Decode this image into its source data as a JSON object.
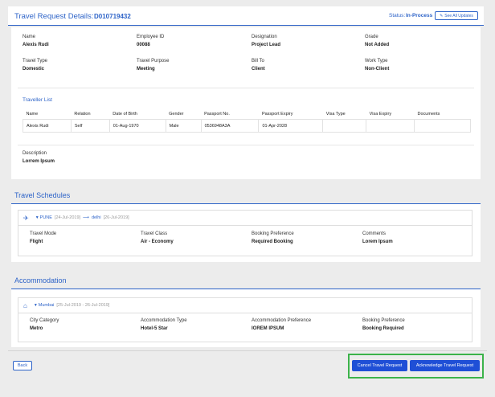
{
  "header": {
    "title": "Travel Request Details:",
    "request_id": "D010719432",
    "status_label": "Status:",
    "status_value": "In-Process",
    "see_updates_label": "See All Updates"
  },
  "details": {
    "row1": [
      {
        "label": "Name",
        "value": "Alexis Rudi"
      },
      {
        "label": "Employee ID",
        "value": "00088"
      },
      {
        "label": "Designation",
        "value": "Project Lead"
      },
      {
        "label": "Grade",
        "value": "Not Added"
      }
    ],
    "row2": [
      {
        "label": "Travel Type",
        "value": "Domestic"
      },
      {
        "label": "Travel Purpose",
        "value": "Meeting"
      },
      {
        "label": "Bill To",
        "value": "Client"
      },
      {
        "label": "Work Type",
        "value": "Non-Client"
      }
    ]
  },
  "traveller_list": {
    "title": "Traveller List",
    "columns": [
      "Name",
      "Relation",
      "Date of Birth",
      "Gender",
      "Passport No.",
      "Passport Expiry",
      "Visa Type",
      "Visa Expiry",
      "Documents"
    ],
    "rows": [
      [
        "Alexis Rudi",
        "Self",
        "01-Aug-1970",
        "Male",
        "0536948A3A",
        "01-Apr-2028",
        "",
        "",
        ""
      ]
    ]
  },
  "description": {
    "label": "Description",
    "value": "Lorrem Ipsum"
  },
  "travel_schedules": {
    "title": "Travel Schedules",
    "route_from": "PUNE",
    "from_date": "[24-Jul-2019]",
    "route_to": "delhi",
    "to_date": "[26-Jul-2019]",
    "fields": [
      {
        "label": "Travel Mode",
        "value": "Flight"
      },
      {
        "label": "Travel Class",
        "value": "Air - Economy"
      },
      {
        "label": "Booking Preference",
        "value": "Required Booking"
      },
      {
        "label": "Comments",
        "value": "Lorem Ipsum"
      }
    ]
  },
  "accommodation": {
    "title": "Accommodation",
    "city": "Mumbai",
    "dates": "[25-Jul-2019 - 26-Jul-2019]",
    "fields": [
      {
        "label": "City Category",
        "value": "Metro"
      },
      {
        "label": "Accommodation Type",
        "value": "Hotel-5 Star"
      },
      {
        "label": "Accommodation Preference",
        "value": "IOREM IPSUM"
      },
      {
        "label": "Booking Preference",
        "value": "Booking Required"
      }
    ]
  },
  "footer": {
    "back_label": "Back",
    "cancel_label": "Cancel Travel Request",
    "acknowledge_label": "Acknowledge Travel Request"
  },
  "colors": {
    "accent": "#2d63c8",
    "primary_button": "#1f4fd6",
    "highlight_border": "#3cb34a"
  }
}
